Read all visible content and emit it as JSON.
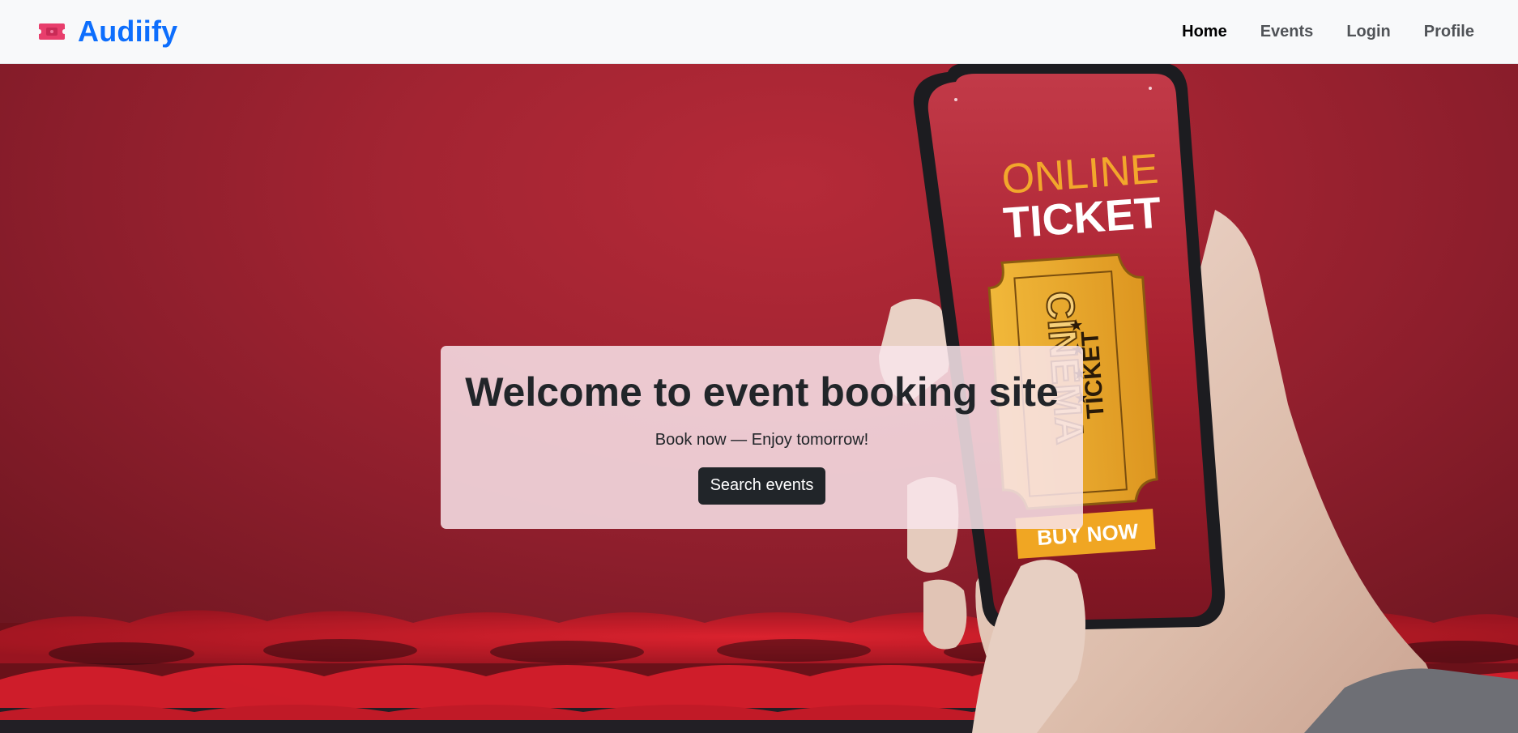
{
  "brand": {
    "name": "Audiify",
    "icon": "ticket-icon",
    "icon_color": "#e83e6c",
    "text_color": "#0d6efd"
  },
  "nav": {
    "items": [
      {
        "label": "Home",
        "active": true
      },
      {
        "label": "Events",
        "active": false
      },
      {
        "label": "Login",
        "active": false
      },
      {
        "label": "Profile",
        "active": false
      }
    ]
  },
  "hero": {
    "background_image": "hand-holding-phone-online-cinema-ticket",
    "phone_screen": {
      "headline_top": "ONLINE",
      "headline_bottom": "TICKET",
      "ticket_word_vertical": "CINEMA",
      "ticket_word_side": "TICKET",
      "cta": "BUY NOW"
    },
    "card": {
      "title": "Welcome to event booking site",
      "subtitle": "Book now — Enjoy tomorrow!",
      "button_label": "Search events"
    }
  },
  "colors": {
    "navbar_bg": "#f8f9fa",
    "hero_red": "#a32432",
    "button_bg": "#212529",
    "phone_ticket_yellow": "#e8a525"
  }
}
